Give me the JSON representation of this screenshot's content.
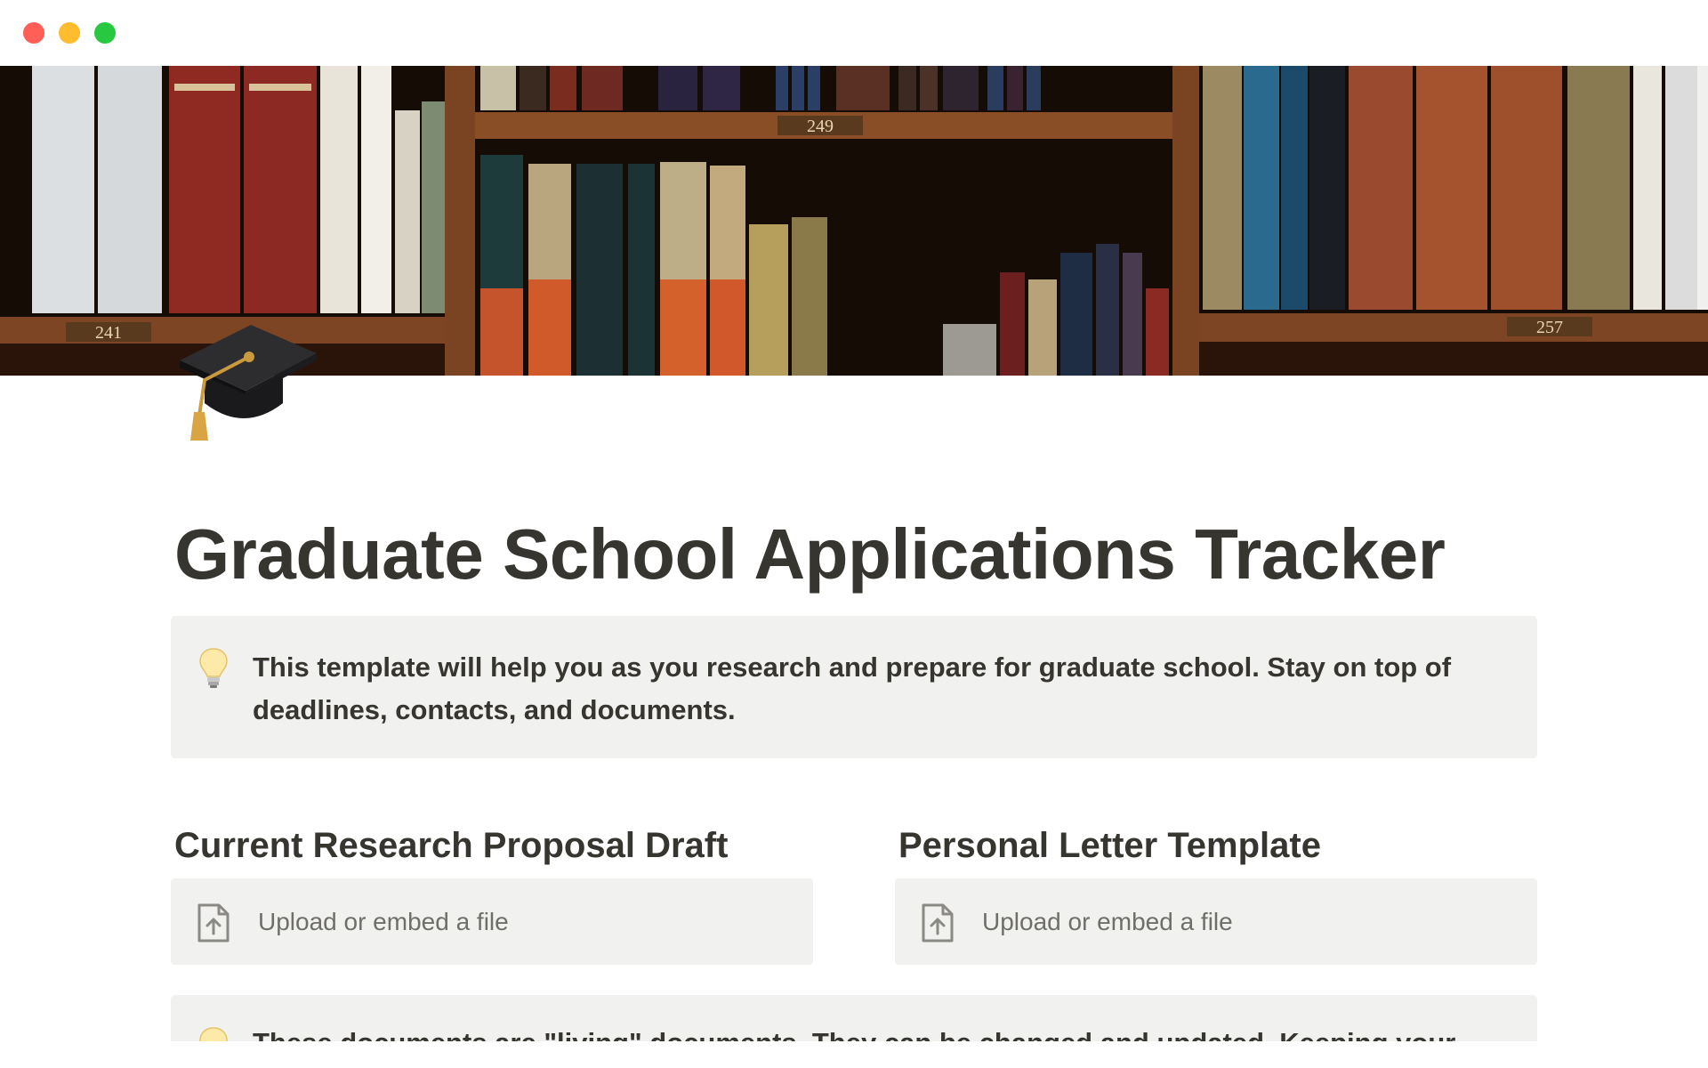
{
  "window": {
    "controls": [
      "close",
      "minimize",
      "zoom"
    ],
    "colors": {
      "close": "#ff5f57",
      "minimize": "#febc2e",
      "zoom": "#28c840"
    }
  },
  "cover": {
    "description_icon": "bookshelf-cover-image",
    "shelf_numbers": [
      "241",
      "249",
      "257"
    ]
  },
  "page": {
    "icon": "graduation-cap-icon",
    "title": "Graduate School Applications Tracker"
  },
  "callout_intro": {
    "icon": "lightbulb-icon",
    "text": "This template will help you as you research and prepare for graduate school. Stay on top of deadlines, contacts, and documents."
  },
  "sections": [
    {
      "heading": "Current Research Proposal Draft",
      "upload_label": "Upload or embed a file",
      "icon": "file-upload-icon"
    },
    {
      "heading": "Personal Letter Template",
      "upload_label": "Upload or embed a file",
      "icon": "file-upload-icon"
    }
  ],
  "callout_note": {
    "icon": "lightbulb-icon",
    "text": "These documents are \"living\" documents. They can be changed and updated. Keeping your most"
  },
  "colors": {
    "text": "#37352f",
    "muted_text": "#6f6e69",
    "callout_bg": "#f1f1ef"
  }
}
